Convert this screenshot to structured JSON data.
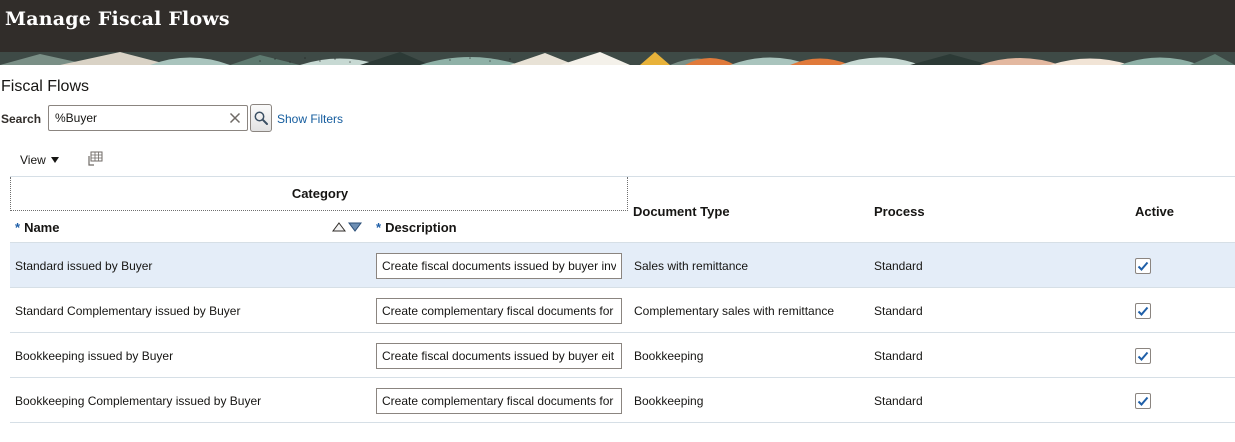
{
  "header": {
    "title": "Manage Fiscal Flows"
  },
  "page": {
    "section_title": "Fiscal Flows"
  },
  "search": {
    "label": "Search",
    "value": "%Buyer",
    "show_filters": "Show Filters"
  },
  "toolbar": {
    "view_label": "View"
  },
  "table": {
    "group_header": "Category",
    "columns": {
      "name": "Name",
      "description": "Description",
      "document_type": "Document Type",
      "process": "Process",
      "active": "Active"
    },
    "required_marker": "*",
    "rows": [
      {
        "name": "Standard issued by Buyer",
        "description": "Create fiscal documents issued by buyer inv",
        "document_type": "Sales with remittance",
        "process": "Standard",
        "active": true
      },
      {
        "name": "Standard Complementary issued by Buyer",
        "description": "Create complementary fiscal documents for",
        "document_type": "Complementary sales with remittance",
        "process": "Standard",
        "active": true
      },
      {
        "name": "Bookkeeping issued by Buyer",
        "description": "Create fiscal documents issued by buyer eit",
        "document_type": "Bookkeeping",
        "process": "Standard",
        "active": true
      },
      {
        "name": "Bookkeeping Complementary issued by Buyer",
        "description": "Create complementary fiscal documents for",
        "document_type": "Bookkeeping",
        "process": "Standard",
        "active": true
      }
    ]
  },
  "colors": {
    "header_bg": "#312d2a",
    "link": "#145c9e",
    "selected_row": "#e4edf8",
    "required": "#1f5fa8",
    "check": "#1f5fa8"
  }
}
